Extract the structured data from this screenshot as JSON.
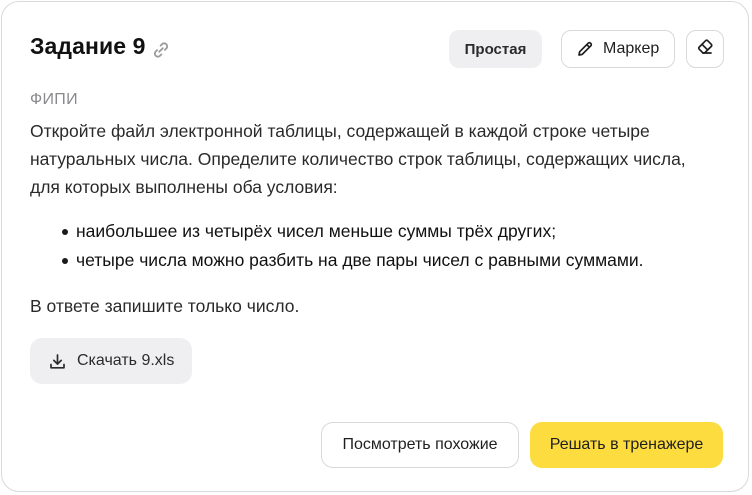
{
  "header": {
    "title": "Задание 9",
    "difficulty_badge": "Простая",
    "marker_label": "Маркер"
  },
  "task": {
    "source": "ФИПИ",
    "text": "Откройте файл электронной таблицы, содержащей в каждой строке четыре натуральных числа. Определите количество строк таблицы, содержащих числа, для которых выполнены оба условия:",
    "conditions": [
      "наибольшее из четырёх чисел меньше суммы трёх других;",
      "четыре числа можно разбить на две пары чисел с равными суммами."
    ],
    "answer_note": "В ответе запишите только число."
  },
  "download": {
    "label": "Скачать 9.xls"
  },
  "actions": {
    "similar_label": "Посмотреть похожие",
    "solve_label": "Решать в тренажере"
  },
  "icons": {
    "link": "link-icon",
    "marker": "pencil-icon",
    "eraser": "eraser-icon",
    "download": "download-icon"
  },
  "colors": {
    "primary_button": "#fddc3f",
    "secondary_fill": "#efeff1",
    "border": "#d9d9dc",
    "source_text": "#8a8a8e"
  }
}
